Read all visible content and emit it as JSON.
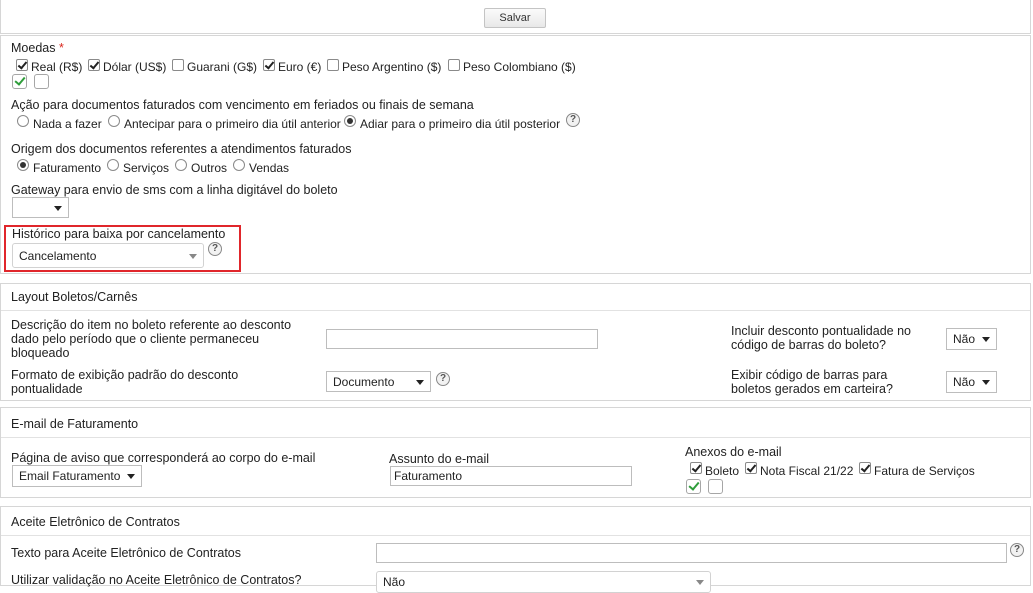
{
  "toolbar": {
    "save_label": "Salvar"
  },
  "moedas": {
    "label": "Moedas",
    "required_mark": "*",
    "options": [
      {
        "label": "Real (R$)",
        "checked": true
      },
      {
        "label": "Dólar (US$)",
        "checked": true
      },
      {
        "label": "Guarani (G$)",
        "checked": false
      },
      {
        "label": "Euro (€)",
        "checked": true
      },
      {
        "label": "Peso Argentino ($)",
        "checked": false
      },
      {
        "label": "Peso Colombiano ($)",
        "checked": false
      }
    ]
  },
  "acao": {
    "label": "Ação para documentos faturados com vencimento em feriados ou finais de semana",
    "options": [
      {
        "label": "Nada a fazer",
        "selected": false
      },
      {
        "label": "Antecipar para o primeiro dia útil anterior",
        "selected": false
      },
      {
        "label": "Adiar para o primeiro dia útil posterior",
        "selected": true
      }
    ],
    "help": "?"
  },
  "origem": {
    "label": "Origem dos documentos referentes a atendimentos faturados",
    "options": [
      {
        "label": "Faturamento",
        "selected": true
      },
      {
        "label": "Serviços",
        "selected": false
      },
      {
        "label": "Outros",
        "selected": false
      },
      {
        "label": "Vendas",
        "selected": false
      }
    ]
  },
  "gateway": {
    "label": "Gateway para envio de sms com a linha digitável do boleto",
    "value": ""
  },
  "historico": {
    "label": "Histórico para baixa por cancelamento",
    "value": "Cancelamento",
    "help": "?"
  },
  "layout": {
    "title": "Layout Boletos/Carnês",
    "descricao_label": "Descrição do item no boleto referente ao desconto dado pelo período que o cliente permaneceu bloqueado",
    "descricao_value": "",
    "incluir_label": "Incluir desconto pontualidade no código de barras do boleto?",
    "incluir_value": "Não",
    "formato_label": "Formato de exibição padrão do desconto pontualidade",
    "formato_value": "Documento",
    "formato_help": "?",
    "exibir_label": "Exibir código de barras para boletos gerados em carteira?",
    "exibir_value": "Não"
  },
  "email": {
    "title": "E-mail de Faturamento",
    "pagina_label": "Página de aviso que corresponderá ao corpo do e-mail",
    "pagina_value": "Email Faturamento",
    "assunto_label": "Assunto do e-mail",
    "assunto_value": "Faturamento",
    "anexos_label": "Anexos do e-mail",
    "anexos": [
      {
        "label": "Boleto",
        "checked": true
      },
      {
        "label": "Nota Fiscal 21/22",
        "checked": true
      },
      {
        "label": "Fatura de Serviços",
        "checked": true
      }
    ]
  },
  "aceite": {
    "title": "Aceite Eletrônico de Contratos",
    "texto_label": "Texto para Aceite Eletrônico de Contratos",
    "texto_value": "",
    "texto_help": "?",
    "utilizar_label": "Utilizar validação no Aceite Eletrônico de Contratos?",
    "utilizar_value": "Não"
  },
  "colors": {
    "highlight_border": "#e0262b",
    "check_green": "#2e9d3a"
  }
}
